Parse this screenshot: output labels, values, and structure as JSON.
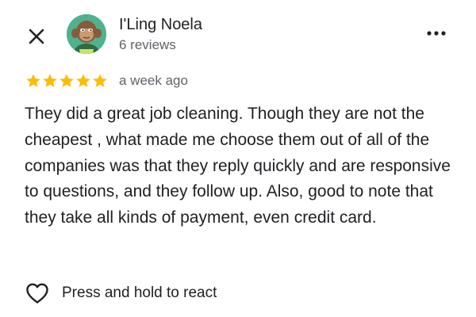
{
  "header": {
    "close_icon": "close-icon",
    "more_icon": "more-horizontal-icon"
  },
  "reviewer": {
    "name": "I'Ling Noela",
    "reviews_count": "6 reviews",
    "avatar": "avatar-image"
  },
  "review": {
    "rating": 5,
    "rating_max": 5,
    "star_color": "#fbbc04",
    "time_ago": "a week ago",
    "text": "They did a great job cleaning. Though they are not the cheapest , what made me choose them out of all of the companies was that they reply quickly and are responsive to questions, and they follow up. Also, good to note that they take all kinds of payment, even credit card."
  },
  "react": {
    "icon": "heart-outline-icon",
    "label": "Press and hold to react"
  }
}
